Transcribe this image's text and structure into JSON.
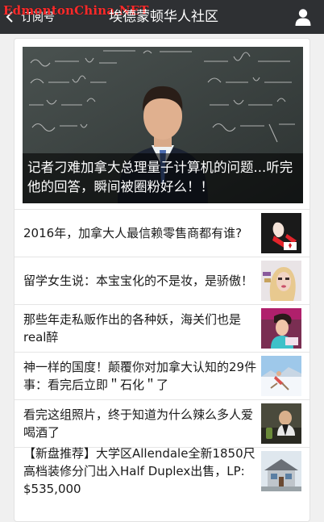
{
  "header": {
    "watermark": "EdmontonChina.NET",
    "back_label": "订阅号",
    "title": "埃德蒙顿华人社区"
  },
  "hero": {
    "caption": "记者刁难加拿大总理量子计算机的问题...听完他的回答，瞬间被圈粉好么！！"
  },
  "articles": [
    {
      "title": "2016年，加拿大人最信赖零售商都有谁?"
    },
    {
      "title": "留学女生说：本宝宝化的不是妆，是骄傲！"
    },
    {
      "title": "那些年走私贩作出的各种妖，海关们也是real醉"
    },
    {
      "title": "神一样的国度！颠覆你对加拿大认知的29件事：看完后立即＂石化＂了"
    },
    {
      "title": "看完这组照片，终于知道为什么辣么多人爱喝酒了"
    },
    {
      "title": "【新盘推荐】大学区Allendale全新1850尺高档装修分门出入Half Duplex出售，LP: $535,000"
    }
  ]
}
